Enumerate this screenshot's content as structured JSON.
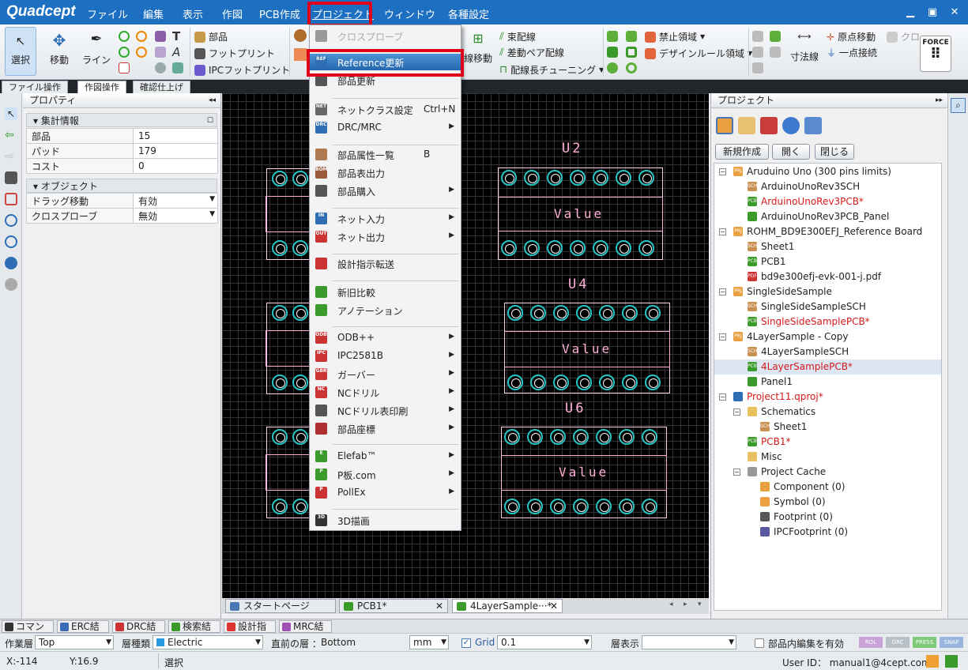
{
  "app": {
    "logo": "Quadcept"
  },
  "menubar": {
    "items": [
      "ファイル",
      "編集",
      "表示",
      "作図",
      "PCB作成",
      "プロジェクト",
      "ウィンドウ",
      "各種設定"
    ],
    "active": "プロジェクト"
  },
  "window_controls": [
    "▁",
    "▣",
    "✕"
  ],
  "ribbon": {
    "select": "選択",
    "move": "移動",
    "line": "ライン",
    "parts": "部品",
    "footprint": "フットプリント",
    "ipc_footprint": "IPCフットプリント",
    "cross_probe": "クロスプローブ",
    "bundle": "束配線",
    "diff_pair": "差動ペア配線",
    "length_tune": "配線長チューニング",
    "bundle_move": "線移動",
    "prohibit": "禁止領域",
    "design_rule": "デザインルール領域",
    "dimension": "寸法線",
    "origin_move": "原点移動",
    "single_connect": "一点接続",
    "clo": "クロ",
    "force": "FORCE"
  },
  "ribbon_tabs": [
    "ファイル操作",
    "作図操作",
    "確認仕上げ"
  ],
  "properties": {
    "title": "プロパティ",
    "sections": [
      {
        "title": "集計情報",
        "rows": [
          [
            "部品",
            "15"
          ],
          [
            "パッド",
            "179"
          ],
          [
            "コスト",
            "0"
          ]
        ]
      },
      {
        "title": "オブジェクト",
        "rows": [
          [
            "ドラッグ移動",
            "有効"
          ],
          [
            "クロスプローブ",
            "無効"
          ]
        ]
      }
    ]
  },
  "dropdown": {
    "items": [
      {
        "label": "クロスプローブ",
        "disabled": true
      },
      {
        "label": "Reference更新",
        "highlighted": true,
        "icon": "REF"
      },
      {
        "label": "部品更新"
      },
      {
        "label": "ネットクラス設定",
        "shortcut": "Ctrl+N",
        "icon": "NET"
      },
      {
        "label": "DRC/MRC",
        "submenu": true,
        "icon": "DRC"
      },
      {
        "label": "部品属性一覧",
        "shortcut": "B"
      },
      {
        "label": "部品表出力",
        "icon": "BOM"
      },
      {
        "label": "部品購入",
        "submenu": true
      },
      {
        "label": "ネット入力",
        "submenu": true,
        "icon": "IN"
      },
      {
        "label": "ネット出力",
        "submenu": true,
        "icon": "OUT"
      },
      {
        "label": "設計指示転送"
      },
      {
        "label": "新旧比較"
      },
      {
        "label": "アノテーション"
      },
      {
        "label": "ODB++",
        "submenu": true,
        "icon": "ODB"
      },
      {
        "label": "IPC2581B",
        "submenu": true,
        "icon": "IPC"
      },
      {
        "label": "ガーバー",
        "submenu": true,
        "icon": "GBR"
      },
      {
        "label": "NCドリル",
        "submenu": true,
        "icon": "NC"
      },
      {
        "label": "NCドリル表印刷",
        "submenu": true
      },
      {
        "label": "部品座標",
        "submenu": true
      },
      {
        "label": "Elefab™",
        "submenu": true,
        "icon": "E"
      },
      {
        "label": "P板.com",
        "submenu": true,
        "icon": "P"
      },
      {
        "label": "PollEx",
        "submenu": true,
        "icon": "P"
      },
      {
        "label": "3D描画",
        "icon": "3D"
      }
    ]
  },
  "canvas": {
    "refs": [
      "U2",
      "U4",
      "U6"
    ],
    "value_label": "Value"
  },
  "project": {
    "title": "プロジェクト",
    "buttons": [
      "新規作成",
      "開く",
      "閉じる"
    ],
    "tree": [
      {
        "label": "Aruduino Uno (300 pins limits)",
        "type": "PRJ",
        "level": 0
      },
      {
        "label": "ArduinoUnoRev3SCH",
        "type": "SCH",
        "level": 1
      },
      {
        "label": "ArduinoUnoRev3PCB*",
        "type": "PCB",
        "level": 1,
        "modified": true
      },
      {
        "label": "ArduinoUnoRev3PCB_Panel",
        "type": "PNL",
        "level": 1
      },
      {
        "label": "ROHM_BD9E300EFJ_Reference Board",
        "type": "PRJ",
        "level": 0
      },
      {
        "label": "Sheet1",
        "type": "SCH",
        "level": 1
      },
      {
        "label": "PCB1",
        "type": "PCB",
        "level": 1
      },
      {
        "label": "bd9e300efj-evk-001-j.pdf",
        "type": "PDF",
        "level": 1
      },
      {
        "label": "SingleSideSample",
        "type": "PRJ",
        "level": 0
      },
      {
        "label": "SingleSideSampleSCH",
        "type": "SCH",
        "level": 1
      },
      {
        "label": "SingleSideSamplePCB*",
        "type": "PCB",
        "level": 1,
        "modified": true
      },
      {
        "label": "4LayerSample - Copy",
        "type": "PRJ",
        "level": 0
      },
      {
        "label": "4LayerSampleSCH",
        "type": "SCH",
        "level": 1
      },
      {
        "label": "4LayerSamplePCB*",
        "type": "PCB",
        "level": 1,
        "modified": true,
        "selected": true
      },
      {
        "label": "Panel1",
        "type": "PNL",
        "level": 1
      },
      {
        "label": "Project11.qproj*",
        "type": "QPRJ",
        "level": 0,
        "modified": true
      },
      {
        "label": "Schematics",
        "type": "FOLDER",
        "level": 1
      },
      {
        "label": "Sheet1",
        "type": "SCH",
        "level": 2
      },
      {
        "label": "PCB1*",
        "type": "PCB",
        "level": 1,
        "modified": true
      },
      {
        "label": "Misc",
        "type": "FOLDER",
        "level": 1
      },
      {
        "label": "Project Cache",
        "type": "CACHE",
        "level": 1
      },
      {
        "label": "Component (0)",
        "type": "COMP",
        "level": 2
      },
      {
        "label": "Symbol (0)",
        "type": "SYM",
        "level": 2
      },
      {
        "label": "Footprint (0)",
        "type": "FP",
        "level": 2
      },
      {
        "label": "IPCFootprint (0)",
        "type": "IPCFP",
        "level": 2
      }
    ]
  },
  "doc_tabs": [
    "スタートページ",
    "PCB1*",
    "4LayerSample···*"
  ],
  "bottom_tabs": [
    "コマンド",
    "ERC結果",
    "DRC結果",
    "検索結果",
    "設計指示",
    "MRC結果"
  ],
  "layer_bar": {
    "work_layer_label": "作業層",
    "work_layer": "Top",
    "layer_type_label": "層種類",
    "layer_type": "Electric",
    "prev_layer_label": "直前の層 ：",
    "prev_layer": "Bottom",
    "unit": "mm",
    "grid_label": "Grid",
    "grid_value": "0.1",
    "layer_display_label": "層表示",
    "in_part_edit": "部品内編集を有効",
    "badges": [
      "ROL",
      "DRC",
      "PRESS",
      "SNAP"
    ]
  },
  "status": {
    "x": "X:-114",
    "y": "Y:16.9",
    "mode": "選択",
    "user": "User ID： manual1@4cept.com"
  }
}
